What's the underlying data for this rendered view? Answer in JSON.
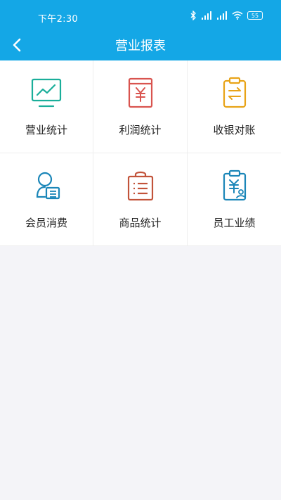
{
  "status_bar": {
    "time": "下午2:30",
    "battery": "55"
  },
  "header": {
    "title": "营业报表"
  },
  "colors": {
    "primary": "#14a7e6",
    "teal": "#1aae9a",
    "red": "#d9544f",
    "amber": "#e8a317",
    "blue": "#1b86b8",
    "rust": "#c2533a"
  },
  "tiles": [
    {
      "label": "营业统计",
      "icon": "line-chart-monitor-icon"
    },
    {
      "label": "利润统计",
      "icon": "yen-receipt-icon"
    },
    {
      "label": "收银对账",
      "icon": "exchange-clipboard-icon"
    },
    {
      "label": "会员消费",
      "icon": "member-card-icon"
    },
    {
      "label": "商品统计",
      "icon": "shopping-bag-list-icon"
    },
    {
      "label": "员工业绩",
      "icon": "staff-clipboard-icon"
    }
  ]
}
